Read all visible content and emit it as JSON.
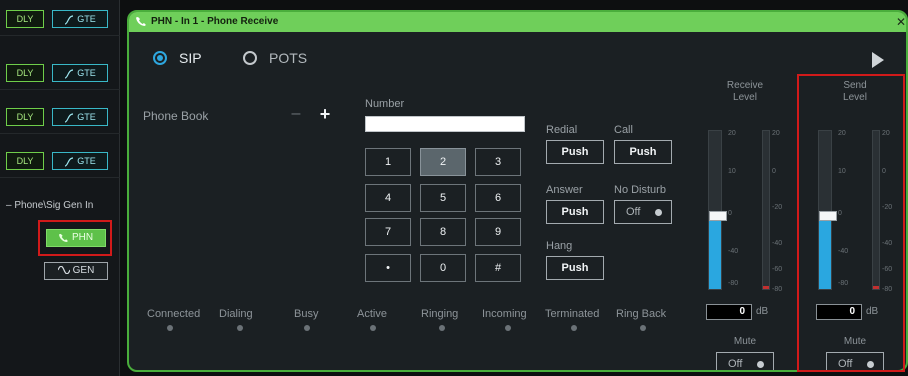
{
  "left_panel": {
    "rows": [
      {
        "dly": "DLY",
        "gte": "GTE"
      },
      {
        "dly": "DLY",
        "gte": "GTE"
      },
      {
        "dly": "DLY",
        "gte": "GTE"
      },
      {
        "dly": "DLY",
        "gte": "GTE"
      }
    ],
    "section_label": "– Phone\\Sig Gen In",
    "phn_label": "PHN",
    "gen_label": "GEN"
  },
  "dialog": {
    "title": "PHN - In 1 - Phone Receive",
    "close": "✕",
    "modes": {
      "sip": "SIP",
      "pots": "POTS",
      "selected": "SIP"
    },
    "phone_book_label": "Phone Book",
    "minus": "–",
    "plus": "+",
    "number_label": "Number",
    "number_value": "",
    "keypad": [
      "1",
      "2",
      "3",
      "4",
      "5",
      "6",
      "7",
      "8",
      "9",
      "•",
      "0",
      "#"
    ],
    "keypad_selected": "2",
    "redial": {
      "label": "Redial",
      "button": "Push"
    },
    "call": {
      "label": "Call",
      "button": "Push"
    },
    "answer": {
      "label": "Answer",
      "button": "Push"
    },
    "no_disturb": {
      "label": "No Disturb",
      "value": "Off"
    },
    "hang": {
      "label": "Hang",
      "button": "Push"
    },
    "status": [
      "Connected",
      "Dialing",
      "Busy",
      "Active",
      "Ringing",
      "Incoming",
      "Terminated",
      "Ring Back"
    ],
    "receive": {
      "title_line1": "Receive",
      "title_line2": "Level",
      "db_value": "0",
      "db_unit": "dB",
      "mute_label": "Mute",
      "mute_value": "Off",
      "level_fraction": 0.46
    },
    "send": {
      "title_line1": "Send",
      "title_line2": "Level",
      "db_value": "0",
      "db_unit": "dB",
      "mute_label": "Mute",
      "mute_value": "Off",
      "level_fraction": 0.46
    },
    "scale_left": [
      "20",
      "10",
      "0",
      "-40",
      "-80"
    ],
    "scale_right": [
      "20",
      "0",
      "-20",
      "-40",
      "-60",
      "-80"
    ],
    "colors": {
      "accent": "#6fcf5a",
      "fader": "#2aa7e0",
      "highlight": "#d11a1a"
    }
  }
}
